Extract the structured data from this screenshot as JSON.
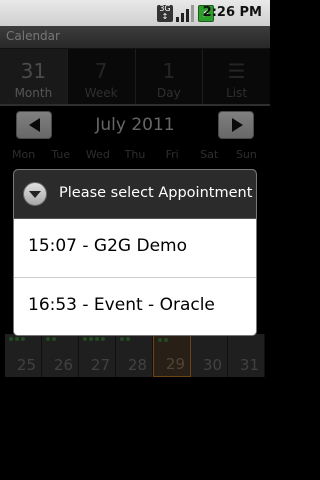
{
  "status_bar": {
    "network": "3G",
    "battery_icon": "battery-charging-icon",
    "time": "2:26 PM"
  },
  "app": {
    "title": "Calendar"
  },
  "tabs": [
    {
      "label": "Month",
      "icon": "31",
      "active": true
    },
    {
      "label": "Week",
      "icon": "7",
      "active": false
    },
    {
      "label": "Day",
      "icon": "1",
      "active": false
    },
    {
      "label": "List",
      "icon": "list-icon",
      "active": false
    }
  ],
  "month_nav": {
    "label": "July 2011"
  },
  "weekdays": [
    "Mon",
    "Tue",
    "Wed",
    "Thu",
    "Fri",
    "Sat",
    "Sun"
  ],
  "week_row": [
    "25",
    "26",
    "27",
    "28",
    "29",
    "30",
    "31"
  ],
  "dialog": {
    "title": "Please select Appointment",
    "items": [
      "15:07 - G2G Demo",
      "16:53 - Event - Oracle"
    ]
  },
  "colors": {
    "today_outline": "#c77a2a",
    "event_dot": "#3c8a3c",
    "battery": "#2e9d2e"
  }
}
